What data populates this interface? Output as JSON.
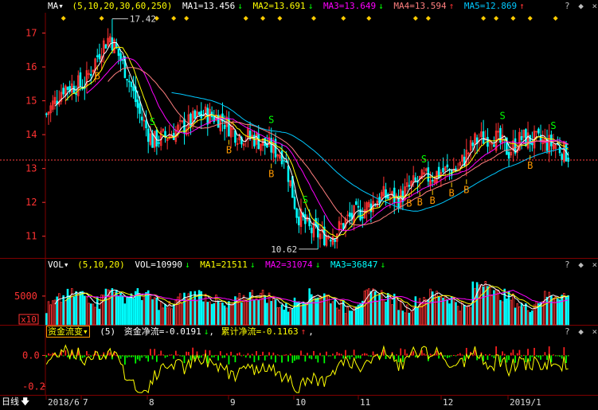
{
  "colors": {
    "up": "#ff3232",
    "down": "#00ffff",
    "ma1": "#ffffff",
    "ma2": "#ffff00",
    "ma3": "#ff00ff",
    "ma4": "#ff7f7f",
    "ma5": "#00c8ff",
    "vol_ma1": "#ffffff",
    "vol_ma2": "#ffff00",
    "vol_ma3": "#ff00ff",
    "grid": "#800000",
    "axis_text": "#ff3232",
    "signal_b": "#ff9900",
    "signal_s": "#00ff00",
    "diamond": "#ffcc00",
    "flow_pos": "#ff2020",
    "flow_neg": "#00ff00",
    "flow_line": "#ffff00"
  },
  "price_header": {
    "name": "MA",
    "params": "(5,10,20,30,60,250)",
    "ma1": "MA1=13.456",
    "ma2": "MA2=13.691",
    "ma3": "MA3=13.649",
    "ma4": "MA4=13.594",
    "ma5": "MA5=12.869",
    "arrow_down": "↓",
    "arrow_up": "↑"
  },
  "vol_header": {
    "name": "VOL",
    "params": "(5,10,20)",
    "vol": "VOL=10990",
    "ma1": "MA1=21511",
    "ma2": "MA2=31074",
    "ma3": "MA3=36847",
    "arrow_down": "↓"
  },
  "flow_header": {
    "name": "资金流变",
    "params": "(5)",
    "net": "资金净流=-0.0191",
    "cum": "累计净流=-0.1163",
    "arrow_down": "↓",
    "arrow_up": "↑",
    "tail": ","
  },
  "corner_icons": {
    "help": "?",
    "expand": "◆",
    "close": "×"
  },
  "price_axis": {
    "ticks": [
      "17",
      "16",
      "15",
      "14",
      "13",
      "12",
      "11"
    ]
  },
  "vol_axis": {
    "ticks": [
      "5000"
    ],
    "unit": "x10"
  },
  "flow_axis": {
    "ticks": [
      "0.0",
      "-0.2"
    ]
  },
  "annotations": {
    "high": "17.42",
    "low": "10.62",
    "buy": "B",
    "sell": "S"
  },
  "date_axis": {
    "period_label": "日线",
    "labels": [
      "2018/6",
      "7",
      "8",
      "9",
      "10",
      "11",
      "12",
      "2019/1"
    ]
  },
  "chart_data": {
    "type": "candlestick",
    "series": [
      "MA1",
      "MA2",
      "MA3",
      "MA4",
      "MA5"
    ],
    "ylim": [
      10.5,
      17.6
    ],
    "high": 17.42,
    "low": 10.62,
    "last_ma": {
      "MA1": 13.456,
      "MA2": 13.691,
      "MA3": 13.649,
      "MA4": 13.594,
      "MA5": 12.869
    },
    "volume_ylim": [
      0,
      9000
    ],
    "flow_ylim": [
      -0.25,
      0.1
    ]
  }
}
